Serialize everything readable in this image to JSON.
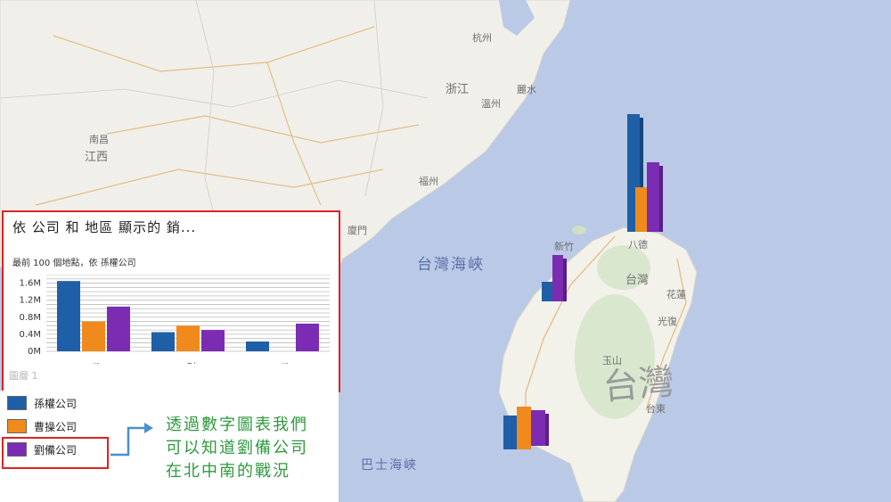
{
  "map": {
    "labels": {
      "taiwan_large": "台灣",
      "taiwan_small": "台灣",
      "strait": "台灣海峽",
      "bashi": "巴士海峽",
      "hangzhou": "杭州",
      "zhejiang": "浙江",
      "wenzhou": "溫州",
      "lishui": "麗水",
      "nanchang": "南昌",
      "jiangxi": "江西",
      "fuzhou": "福州",
      "xiamen": "廈門",
      "hsinchu": "新竹",
      "taoyuan": "八德",
      "hualien": "花蓮",
      "taitung": "台東",
      "guangfu": "光復",
      "yushan": "玉山"
    }
  },
  "chart": {
    "title": "依 公司 和 地區 顯示的 銷...",
    "subtitle": "最前 100 個地點，依 孫權公司",
    "layer_label": "圖層 1"
  },
  "chart_data": {
    "type": "bar",
    "categories": [
      "台北",
      "高雄",
      "台中"
    ],
    "series": [
      {
        "name": "孫權公司",
        "values": [
          1650000,
          450000,
          230000
        ]
      },
      {
        "name": "曹操公司",
        "values": [
          700000,
          600000,
          0
        ]
      },
      {
        "name": "劉備公司",
        "values": [
          1050000,
          500000,
          650000
        ]
      }
    ],
    "y_ticks": [
      "0M",
      "0.4M",
      "0.8M",
      "1.2M",
      "1.6M"
    ],
    "ylim": [
      0,
      1800000
    ],
    "grid": true
  },
  "legend": {
    "items": [
      {
        "label": "孫權公司",
        "color": "#1f5fa8"
      },
      {
        "label": "曹操公司",
        "color": "#f08a1c"
      },
      {
        "label": "劉備公司",
        "color": "#7b2cb3"
      }
    ]
  },
  "annotation": {
    "lines": [
      "透過數字圖表我們",
      "可以知道劉備公司",
      "在北中南的戰況"
    ]
  },
  "colors": {
    "accent_red": "#d22222",
    "annotation_green": "#2e9a3e",
    "sea": "#b9c9e6"
  }
}
